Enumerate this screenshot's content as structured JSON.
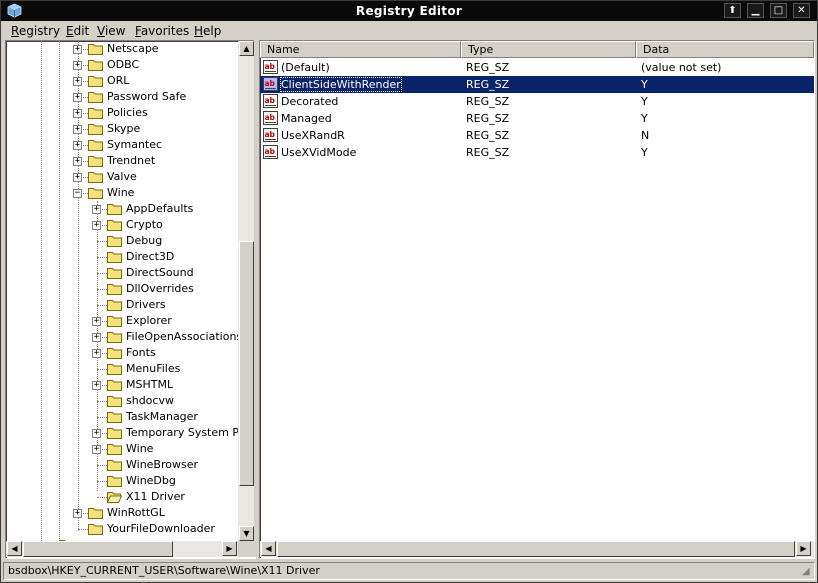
{
  "window": {
    "title": "Registry Editor",
    "app_icon": "regedit-cube-icon",
    "controls": [
      "restore-up-icon",
      "minimize-icon",
      "maximize-icon",
      "close-icon"
    ]
  },
  "menubar": {
    "items": [
      {
        "label": "Registry",
        "accel": "R"
      },
      {
        "label": "Edit",
        "accel": "E"
      },
      {
        "label": "View",
        "accel": "V"
      },
      {
        "label": "Favorites",
        "accel": "F"
      },
      {
        "label": "Help",
        "accel": "H"
      }
    ]
  },
  "tree": {
    "nodes": [
      {
        "label": "Netscape",
        "level": 1,
        "expander": "+"
      },
      {
        "label": "ODBC",
        "level": 1,
        "expander": "+"
      },
      {
        "label": "ORL",
        "level": 1,
        "expander": "+"
      },
      {
        "label": "Password Safe",
        "level": 1,
        "expander": "+"
      },
      {
        "label": "Policies",
        "level": 1,
        "expander": "+"
      },
      {
        "label": "Skype",
        "level": 1,
        "expander": "+"
      },
      {
        "label": "Symantec",
        "level": 1,
        "expander": "+"
      },
      {
        "label": "Trendnet",
        "level": 1,
        "expander": "+"
      },
      {
        "label": "Valve",
        "level": 1,
        "expander": "+"
      },
      {
        "label": "Wine",
        "level": 1,
        "expander": "-"
      },
      {
        "label": "AppDefaults",
        "level": 2,
        "expander": "+"
      },
      {
        "label": "Crypto",
        "level": 2,
        "expander": "+"
      },
      {
        "label": "Debug",
        "level": 2,
        "expander": ""
      },
      {
        "label": "Direct3D",
        "level": 2,
        "expander": ""
      },
      {
        "label": "DirectSound",
        "level": 2,
        "expander": ""
      },
      {
        "label": "DllOverrides",
        "level": 2,
        "expander": ""
      },
      {
        "label": "Drivers",
        "level": 2,
        "expander": ""
      },
      {
        "label": "Explorer",
        "level": 2,
        "expander": "+"
      },
      {
        "label": "FileOpenAssociations",
        "level": 2,
        "expander": "+"
      },
      {
        "label": "Fonts",
        "level": 2,
        "expander": "+"
      },
      {
        "label": "MenuFiles",
        "level": 2,
        "expander": ""
      },
      {
        "label": "MSHTML",
        "level": 2,
        "expander": "+"
      },
      {
        "label": "shdocvw",
        "level": 2,
        "expander": ""
      },
      {
        "label": "TaskManager",
        "level": 2,
        "expander": ""
      },
      {
        "label": "Temporary System Par",
        "level": 2,
        "expander": "+"
      },
      {
        "label": "Wine",
        "level": 2,
        "expander": "+"
      },
      {
        "label": "WineBrowser",
        "level": 2,
        "expander": ""
      },
      {
        "label": "WineDbg",
        "level": 2,
        "expander": ""
      },
      {
        "label": "X11 Driver",
        "level": 2,
        "expander": "",
        "open": true,
        "selected": true
      },
      {
        "label": "WinRottGL",
        "level": 1,
        "expander": "+"
      },
      {
        "label": "YourFileDownloader",
        "level": 1,
        "expander": ""
      }
    ]
  },
  "list": {
    "columns": [
      "Name",
      "Type",
      "Data"
    ],
    "rows": [
      {
        "name": "(Default)",
        "type": "REG_SZ",
        "data": "(value not set)",
        "selected": false
      },
      {
        "name": "ClientSideWithRender",
        "type": "REG_SZ",
        "data": "Y",
        "selected": true
      },
      {
        "name": "Decorated",
        "type": "REG_SZ",
        "data": "Y",
        "selected": false
      },
      {
        "name": "Managed",
        "type": "REG_SZ",
        "data": "Y",
        "selected": false
      },
      {
        "name": "UseXRandR",
        "type": "REG_SZ",
        "data": "N",
        "selected": false
      },
      {
        "name": "UseXVidMode",
        "type": "REG_SZ",
        "data": "Y",
        "selected": false
      }
    ]
  },
  "statusbar": {
    "path": "bsdbox\\HKEY_CURRENT_USER\\Software\\Wine\\X11 Driver"
  },
  "colors": {
    "titlebar": "#0a0a0a",
    "selection": "#0a246a",
    "face": "#d4d0c8"
  }
}
